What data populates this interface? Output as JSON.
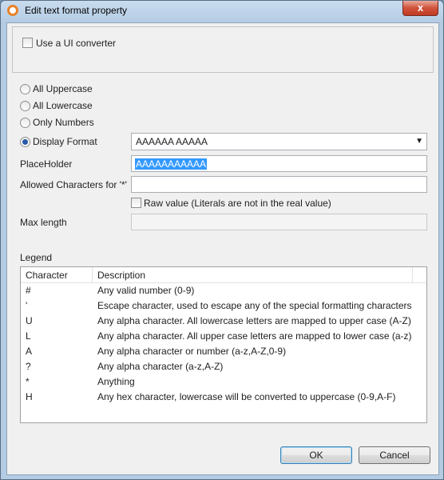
{
  "window": {
    "title": "Edit text format property",
    "close_glyph": "x"
  },
  "converter": {
    "label": "Use a UI converter",
    "checked": false
  },
  "radios": [
    {
      "label": "All Uppercase",
      "checked": false
    },
    {
      "label": "All Lowercase",
      "checked": false
    },
    {
      "label": "Only Numbers",
      "checked": false
    },
    {
      "label": "Display Format",
      "checked": true
    }
  ],
  "display_format": {
    "value": "AAAAAA AAAAA",
    "arrow": "▼"
  },
  "placeholder": {
    "label": "PlaceHolder",
    "value": "AAAAAAAAAAA"
  },
  "allowed": {
    "label": "Allowed Characters for '*'",
    "value": ""
  },
  "raw_value": {
    "label": "Raw value (Literals are not in the real value)",
    "checked": false
  },
  "max_length": {
    "label": "Max length",
    "value": ""
  },
  "legend": {
    "label": "Legend",
    "columns": [
      "Character",
      "Description"
    ],
    "rows": [
      {
        "char": "#",
        "desc": "Any valid number (0-9)"
      },
      {
        "char": "'",
        "desc": "Escape character, used to escape any of the special formatting characters"
      },
      {
        "char": "U",
        "desc": "Any alpha character. All lowercase letters are mapped to upper case (A-Z)"
      },
      {
        "char": "L",
        "desc": "Any alpha character. All upper case letters are mapped to lower case (a-z)"
      },
      {
        "char": "A",
        "desc": "Any alpha character or number (a-z,A-Z,0-9)"
      },
      {
        "char": "?",
        "desc": "Any alpha character (a-z,A-Z)"
      },
      {
        "char": "*",
        "desc": "Anything"
      },
      {
        "char": "H",
        "desc": "Any hex character, lowercase will be converted to uppercase (0-9,A-F)"
      }
    ]
  },
  "buttons": {
    "ok": "OK",
    "cancel": "Cancel"
  },
  "colors": {
    "accent": "#3399ff",
    "close": "#c03a22",
    "app_icon": "#e8822a"
  }
}
